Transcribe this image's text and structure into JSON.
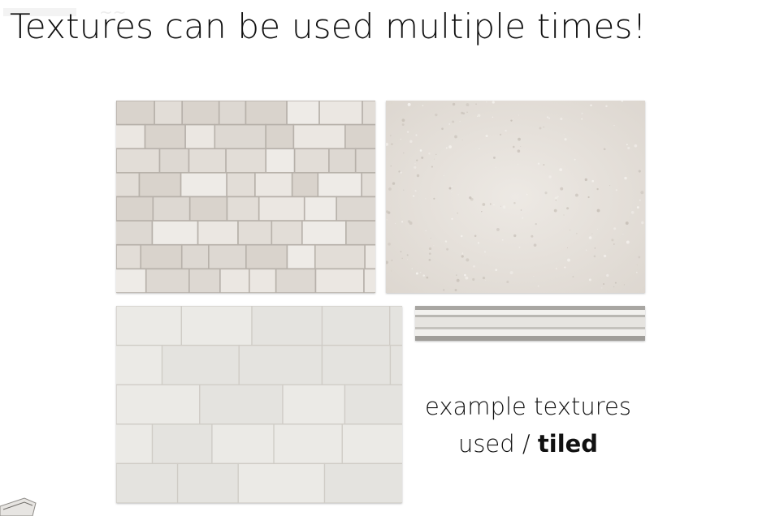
{
  "slide": {
    "title": "Textures can be used multiple times!",
    "caption": {
      "line1": "example textures",
      "line2_prefix": "used / ",
      "line2_bold": "tiled"
    }
  },
  "textures": [
    {
      "name": "stone-brick-wall-texture",
      "kind": "brick"
    },
    {
      "name": "plaster-concrete-texture",
      "kind": "concrete"
    },
    {
      "name": "concrete-block-wall-texture",
      "kind": "blocks"
    },
    {
      "name": "crown-molding-texture",
      "kind": "molding"
    }
  ],
  "colors": {
    "background": "#ffffff",
    "text": "#111111",
    "stone": "#e6e2dd",
    "grout": "#b9b3ac",
    "concrete": "#e8e3de",
    "block": "#e9e8e4",
    "molding": "#dcdad6"
  }
}
